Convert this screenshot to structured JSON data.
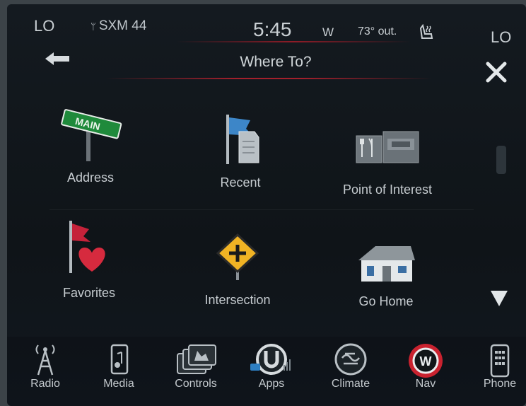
{
  "status_bar": {
    "left_level": "LO",
    "right_level": "LO",
    "source": "SXM 44",
    "time": "5:45",
    "compass": "W",
    "outside_temp": "73° out."
  },
  "header": {
    "title": "Where To?"
  },
  "destinations": [
    {
      "label": "Address",
      "icon": "street-sign-icon"
    },
    {
      "label": "Recent",
      "icon": "recent-flag-icon"
    },
    {
      "label": "Point of Interest",
      "icon": "poi-icon"
    },
    {
      "label": "Favorites",
      "icon": "favorites-heart-icon"
    },
    {
      "label": "Intersection",
      "icon": "intersection-sign-icon"
    },
    {
      "label": "Go Home",
      "icon": "house-icon"
    }
  ],
  "bottom_nav": [
    {
      "label": "Radio",
      "icon": "radio-tower-icon"
    },
    {
      "label": "Media",
      "icon": "media-icon"
    },
    {
      "label": "Controls",
      "icon": "controls-icon"
    },
    {
      "label": "Apps",
      "icon": "apps-icon"
    },
    {
      "label": "Climate",
      "icon": "climate-icon"
    },
    {
      "label": "Nav",
      "icon": "nav-compass-icon",
      "active": true
    },
    {
      "label": "Phone",
      "icon": "phone-icon"
    }
  ],
  "colors": {
    "accent_red": "#a3202c",
    "background": "#121820",
    "text": "#c6ccd0"
  }
}
